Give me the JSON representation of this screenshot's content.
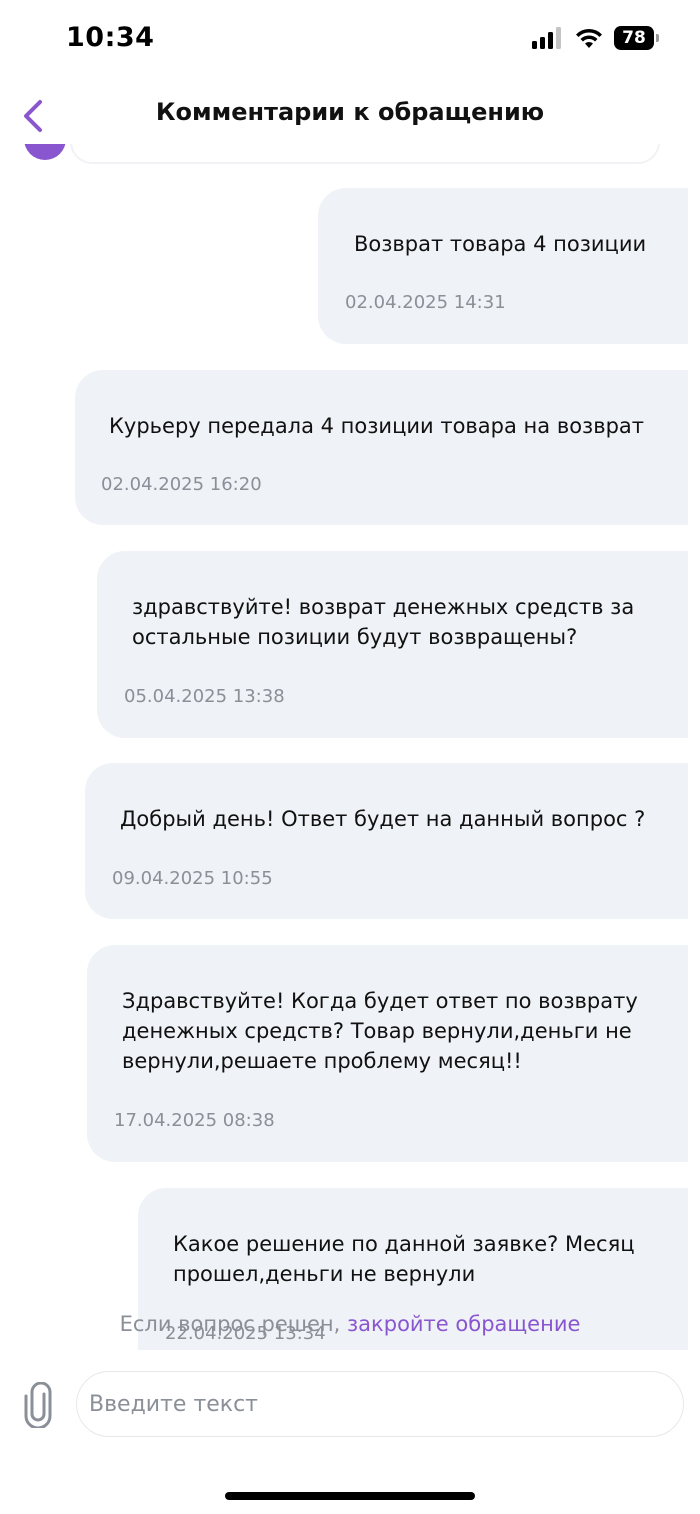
{
  "status_bar": {
    "time": "10:34",
    "battery": "78"
  },
  "header": {
    "title": "Комментарии к обращению",
    "back_icon": "chevron-left-icon",
    "accent_color": "#8a56cf"
  },
  "messages": [
    {
      "text": "Возврат товара 4 позиции",
      "time": "02.04.2025 14:31"
    },
    {
      "text": "Курьеру передала 4 позиции товара на возврат",
      "time": "02.04.2025 16:20"
    },
    {
      "text": "здравствуйте! возврат денежных средств за\nостальные позиции будут возвращены?",
      "time": "05.04.2025 13:38"
    },
    {
      "text": "Добрый день! Ответ будет на данный вопрос ?",
      "time": "09.04.2025 10:55"
    },
    {
      "text": "Здравствуйте! Когда будет ответ по возврату\nденежных средств? Товар вернули,деньги не\nвернули,решаете проблему месяц!!",
      "time": "17.04.2025 08:38"
    },
    {
      "text": "Какое решение по данной заявке? Месяц\nпрошел,деньги не вернули",
      "time": "22.04.2025 13:34"
    }
  ],
  "footer": {
    "hint_text": "Если вопрос решен,",
    "hint_link": "закройте обращение",
    "input_placeholder": "Введите текст",
    "attach_icon": "paperclip-icon"
  }
}
